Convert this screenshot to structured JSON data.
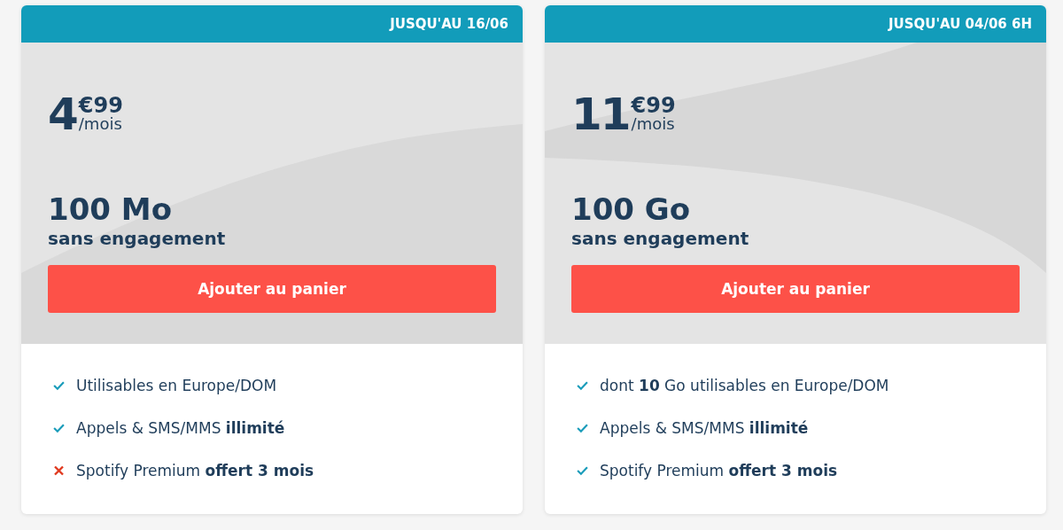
{
  "offers": [
    {
      "deadline": "JUSQU'AU 16/06",
      "price": {
        "whole": "4",
        "cents": "€99",
        "period": "/mois"
      },
      "data": "100 Mo",
      "commitment": "sans engagement",
      "button": "Ajouter au panier",
      "features": [
        {
          "text": "Utilisables en Europe/DOM",
          "included": true
        },
        {
          "text": "Appels & SMS/MMS **illimité**",
          "included": true
        },
        {
          "text": "Spotify Premium **offert 3 mois**",
          "included": false
        }
      ]
    },
    {
      "deadline": "JUSQU'AU 04/06 6H",
      "price": {
        "whole": "11",
        "cents": "€99",
        "period": "/mois"
      },
      "data": "100 Go",
      "commitment": "sans engagement",
      "button": "Ajouter au panier",
      "features": [
        {
          "text": "dont **10** Go utilisables en Europe/DOM",
          "included": true
        },
        {
          "text": "Appels & SMS/MMS **illimité**",
          "included": true
        },
        {
          "text": "Spotify Premium **offert 3 mois**",
          "included": true
        }
      ]
    }
  ]
}
